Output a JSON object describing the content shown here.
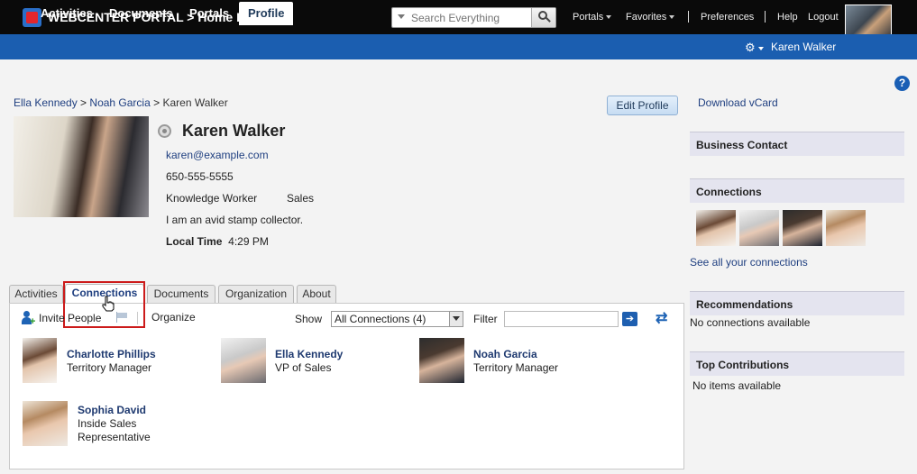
{
  "header": {
    "brand": "WEBCENTER PORTAL > Home Portal",
    "search_placeholder": "Search Everything",
    "links": {
      "portals": "Portals",
      "favorites": "Favorites",
      "preferences": "Preferences",
      "help": "Help",
      "logout": "Logout"
    }
  },
  "nav": {
    "tabs": [
      "Activities",
      "Documents",
      "Portals",
      "Profile"
    ],
    "active": "Profile",
    "user": "Karen Walker"
  },
  "breadcrumb": [
    "Ella Kennedy",
    "Noah Garcia",
    "Karen Walker"
  ],
  "profile": {
    "name": "Karen Walker",
    "email": "karen@example.com",
    "phone": "650-555-5555",
    "title": "Knowledge Worker",
    "department": "Sales",
    "about": "I am an avid stamp collector.",
    "local_time_label": "Local Time",
    "local_time": "4:29 PM",
    "edit_label": "Edit Profile"
  },
  "tabs": [
    "Activities",
    "Connections",
    "Documents",
    "Organization",
    "About"
  ],
  "active_tab": "Connections",
  "toolbar": {
    "invite": "Invite People",
    "organize": "Organize",
    "show_label": "Show",
    "show_value": "All Connections (4)",
    "filter_label": "Filter",
    "filter_value": ""
  },
  "connections": [
    {
      "name": "Charlotte Phillips",
      "title": "Territory Manager"
    },
    {
      "name": "Ella Kennedy",
      "title": "VP of Sales"
    },
    {
      "name": "Noah Garcia",
      "title": "Territory Manager"
    },
    {
      "name": "Sophia David",
      "title_line1": "Inside Sales",
      "title_line2": "Representative"
    }
  ],
  "sidebar": {
    "vcard": "Download vCard",
    "business_contact": "Business Contact",
    "connections": "Connections",
    "see_all": "See all your connections",
    "recommendations": "Recommendations",
    "no_connections": "No connections available",
    "top_contributions": "Top Contributions",
    "no_items": "No items available"
  },
  "colors": {
    "accent": "#1b5eb0",
    "topbar": "#0a0a0a",
    "highlight": "#cc1b1b"
  }
}
